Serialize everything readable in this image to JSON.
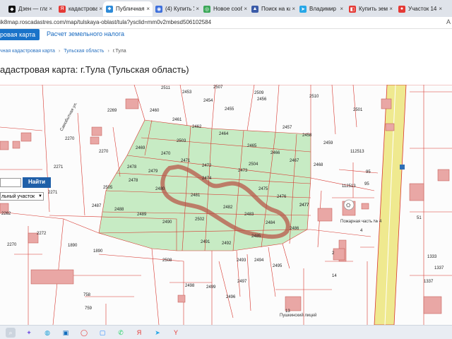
{
  "browser": {
    "tabs": [
      {
        "label": "Дзен — гла",
        "favicon": "zen-icon",
        "color": "#111111",
        "glyph": "◆",
        "active": false
      },
      {
        "label": "кадастровая",
        "favicon": "yandex-icon",
        "color": "#e53935",
        "glyph": "Я",
        "active": false
      },
      {
        "label": "Публичная к",
        "favicon": "map-pin-icon",
        "color": "#2e8bd8",
        "glyph": "⬥",
        "active": true
      },
      {
        "label": "(4) Купить У",
        "favicon": "cian-icon",
        "color": "#3d6fdc",
        "glyph": "◉",
        "active": false
      },
      {
        "label": "Новое сооб",
        "favicon": "message-icon",
        "color": "#3aa757",
        "glyph": "◎",
        "active": false
      },
      {
        "label": "Поиск на ка",
        "favicon": "search-map-icon",
        "color": "#3b5ba8",
        "glyph": "▲",
        "active": false
      },
      {
        "label": "Владимир",
        "favicon": "telegram-icon",
        "color": "#27a7e7",
        "glyph": "➤",
        "active": false
      },
      {
        "label": "Купить земл",
        "favicon": "avito-icon",
        "color": "#e53935",
        "glyph": "◧",
        "active": false
      },
      {
        "label": "Участок 14,",
        "favicon": "avito-icon",
        "color": "#e53935",
        "glyph": "●",
        "active": false
      }
    ],
    "url": "ik8map.roscadastres.com/map/tulskaya-oblast/tula?ysclid=mm0v2mbesd506102584",
    "url_right": "А"
  },
  "header": {
    "map_button": "ровая карта",
    "tax_link": "Расчет земельного налога",
    "breadcrumbs": [
      "чная кадастровая карта",
      "Тульская область",
      "г.Тула"
    ],
    "title": "адастровая карта: г.Тула (Тульская область)"
  },
  "search": {
    "button": "Найти",
    "select_value": "льный участок"
  },
  "map": {
    "colors": {
      "parcel_fill": "#e4f3e1",
      "parcel_green": "#c7ebc4",
      "boundary": "#d7372f",
      "highlight": "#b8584a",
      "road": "#efe98f",
      "building": "#e9a7a5"
    },
    "parcels": [
      "2511",
      "2453",
      "2507",
      "2509",
      "2510",
      "2501",
      "2460",
      "2454",
      "2455",
      "2456",
      "2461",
      "2462",
      "2457",
      "2458",
      "2464",
      "2503",
      "2465",
      "2459",
      "2470",
      "2469",
      "2471",
      "2466",
      "2467",
      "2472",
      "2473",
      "2468",
      "2478",
      "2479",
      "2477",
      "2474",
      "2504",
      "2478",
      "2480",
      "2481",
      "2475",
      "2476",
      "2505",
      "2487",
      "2482",
      "2483",
      "2488",
      "2489",
      "2490",
      "2502",
      "2484",
      "2486",
      "2477",
      "2491",
      "2492",
      "2485",
      "2494",
      "2493",
      "2495",
      "2508",
      "2498",
      "2499",
      "2497",
      "2496",
      "1890",
      "1890",
      "112513",
      "112513",
      "95",
      "95",
      "14",
      "51",
      "1337",
      "1337",
      "1333",
      "2270",
      "2271",
      "2271",
      "2272",
      "2269",
      "2262",
      "2270",
      "2270",
      "758",
      "759"
    ],
    "labels": {
      "street": "Самобытная ул.",
      "building_label": "Пожарная часть № 4",
      "school_label": "Пушкинский лицей",
      "label_13": "13",
      "label_4": "4",
      "label_2": "2"
    }
  },
  "taskbar": {
    "icons": [
      "search-icon",
      "copilot-icon",
      "edge-icon",
      "outlook-icon",
      "opera-icon",
      "zoom-icon",
      "whatsapp-icon",
      "yandex-browser-icon",
      "telegram-icon",
      "yandex-icon"
    ]
  }
}
